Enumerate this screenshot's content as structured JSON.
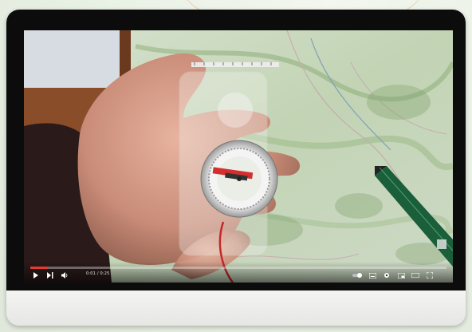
{
  "player": {
    "time_display": "0:01 / 0:25",
    "progress": 0.04,
    "controls": {
      "play": "play-icon",
      "next": "next-icon",
      "volume": "volume-icon",
      "autoplay": "autoplay-toggle-icon",
      "subtitles": "subtitles-icon",
      "settings": "gear-icon",
      "miniplayer": "miniplayer-icon",
      "theater": "theater-mode-icon",
      "fullscreen": "fullscreen-icon"
    }
  },
  "colors": {
    "progress": "#e53935",
    "bezel": "#0c0c0c",
    "chin": "#f1f1ef"
  }
}
